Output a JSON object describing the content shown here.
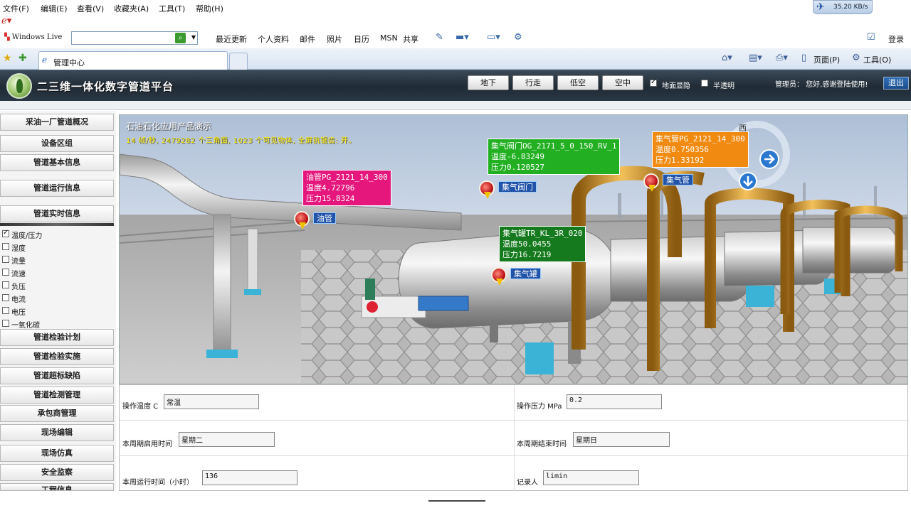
{
  "browser": {
    "menu": [
      "文件(F)",
      "编辑(E)",
      "查看(V)",
      "收藏夹(A)",
      "工具(T)",
      "帮助(H)"
    ],
    "net_speed": "35.20 KB/s",
    "windows_live": "Windows Live",
    "search_placeholder": "",
    "links": [
      "最近更新",
      "个人资料",
      "邮件",
      "照片",
      "日历",
      "MSN",
      "共享"
    ],
    "login": "登录",
    "tab_title": "管理中心",
    "page_menu": "页面(P)",
    "tools_menu": "工具(O)"
  },
  "app": {
    "title": "二三维一体化数字管道平台",
    "view_buttons": [
      "地下",
      "行走",
      "低空",
      "空中"
    ],
    "ground_toggle": {
      "label": "地面显隐",
      "checked": true
    },
    "transparent_toggle": {
      "label": "半透明",
      "checked": false
    },
    "user_greeting": "管理员： 您好,感谢登陆使用!",
    "logout": "退出"
  },
  "sidebar": {
    "top_buttons": [
      "采油一厂管道概况",
      "设备区组",
      "管道基本信息",
      "管道运行信息",
      "管道实时信息"
    ],
    "checks": [
      {
        "label": "温度/压力",
        "checked": true
      },
      {
        "label": "湿度",
        "checked": false
      },
      {
        "label": "流量",
        "checked": false
      },
      {
        "label": "流速",
        "checked": false
      },
      {
        "label": "负压",
        "checked": false
      },
      {
        "label": "电流",
        "checked": false
      },
      {
        "label": "电压",
        "checked": false
      },
      {
        "label": "一氧化碳",
        "checked": false
      }
    ],
    "bottom_buttons": [
      "管道检验计划",
      "管道检验实施",
      "管道超标缺陷",
      "管道检测管理",
      "承包商管理",
      "现场编辑",
      "现场仿真",
      "安全监察",
      "工程信息"
    ]
  },
  "scene": {
    "title": "石油石化应用产品演示",
    "stats": "14 帧/秒, 2479282 个三角面, 1023 个可见物体, 全屏抗锯齿: 开。",
    "compass": "西",
    "tooltips": [
      {
        "id": "oil",
        "color": "#e5177d",
        "name": "油管PG_2121_14_300",
        "temp": "温度4.72796",
        "press": "压力15.8324",
        "marker": "油管"
      },
      {
        "id": "valve",
        "color": "#22b022",
        "name": "集气阀门OG_2171_5_0_150_RV_1",
        "temp": "温度-6.83249",
        "press": "压力0.120527",
        "marker": "集气阀门"
      },
      {
        "id": "gas",
        "color": "#f08a10",
        "name": "集气管PG_2121_14_300",
        "temp": "温度0.750356",
        "press": "压力1.33192",
        "marker": "集气管"
      },
      {
        "id": "tank",
        "color": "#157a1d",
        "name": "集气罐TR_KL_3R_020",
        "temp": "温度50.0455",
        "press": "压力16.7219",
        "marker": "集气罐"
      }
    ]
  },
  "form": {
    "op_temp_label": "操作温度 C",
    "op_temp": "常温",
    "op_press_label": "操作压力 MPa",
    "op_press": "0.2",
    "start_label": "本周期启用时间",
    "start": "星期二",
    "end_label": "本周期结束时间",
    "end": "星期日",
    "runtime_label": "本周运行时间（小时）",
    "runtime": "136",
    "recorder_label": "记录人",
    "recorder": "limin"
  }
}
